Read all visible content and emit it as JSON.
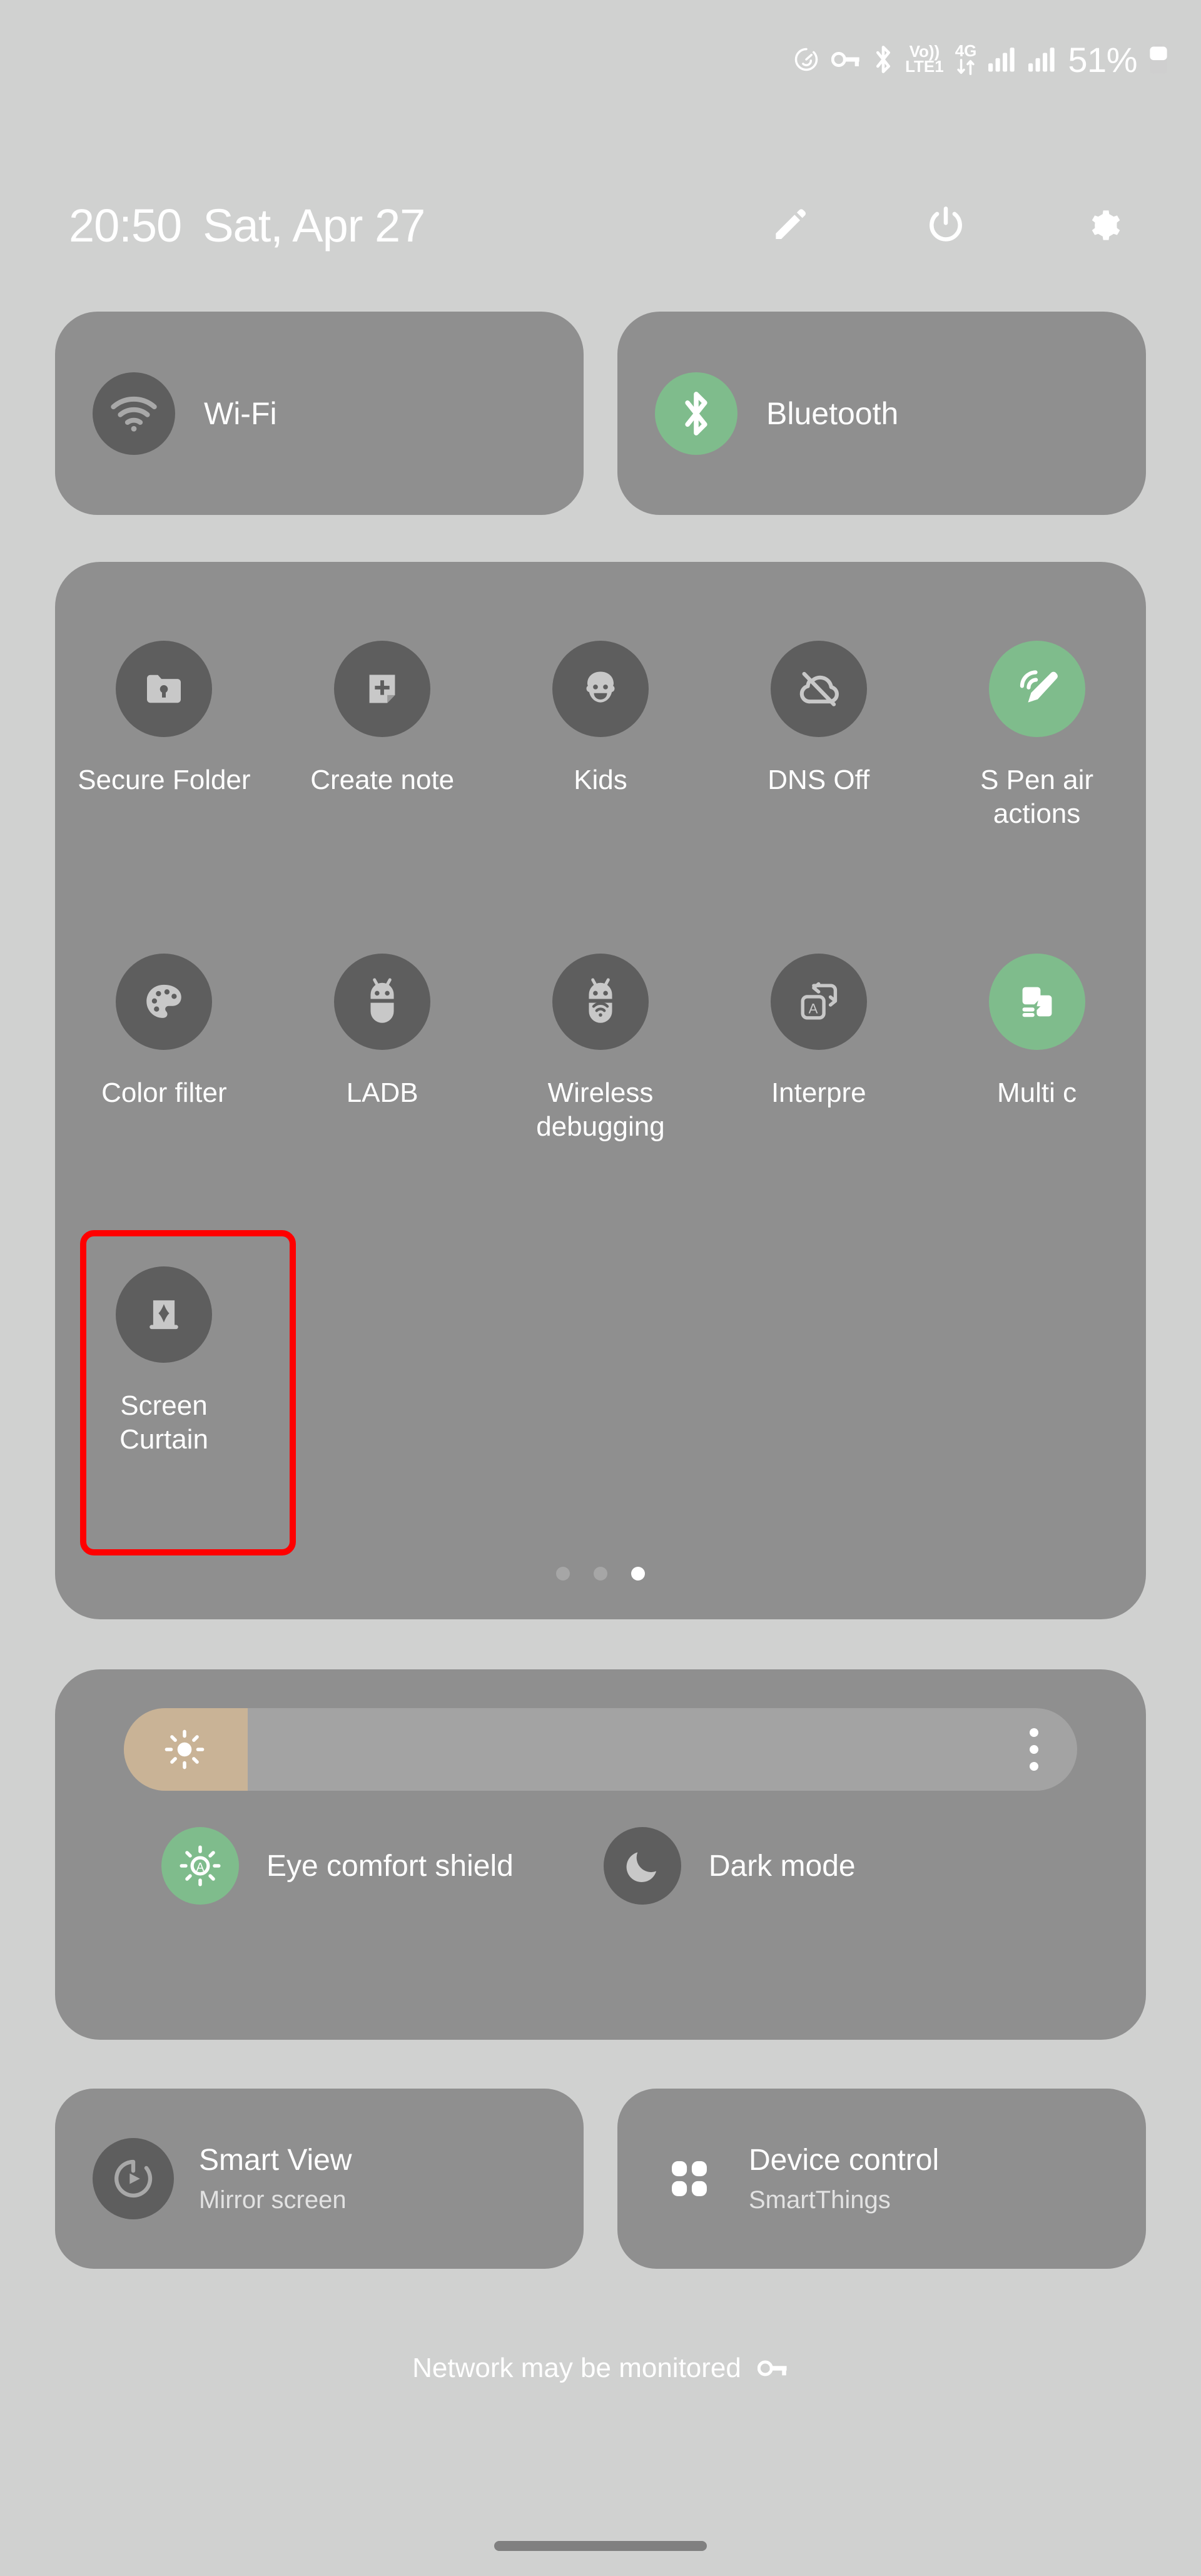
{
  "statusbar": {
    "icons": [
      "dashboard-speed-icon",
      "vpn-key-icon",
      "bluetooth-icon"
    ],
    "volte_top": "Vo))",
    "volte_bottom": "LTE1",
    "network_top": "4G",
    "network_bottom": "arrows-updown-icon",
    "signal_icons": [
      "signal-bars-icon",
      "signal-bars-icon"
    ],
    "battery_percent": "51%",
    "battery_icon": "battery-half-icon"
  },
  "header": {
    "time": "20:50",
    "date": "Sat, Apr 27",
    "actions": [
      {
        "name": "edit-pencil-icon",
        "label": "Edit"
      },
      {
        "name": "power-icon",
        "label": "Power"
      },
      {
        "name": "gear-icon",
        "label": "Settings"
      }
    ]
  },
  "connectivity": [
    {
      "label": "Wi-Fi",
      "icon": "wifi-icon",
      "active": false
    },
    {
      "label": "Bluetooth",
      "icon": "bluetooth-icon",
      "active": true
    }
  ],
  "quick_tiles": {
    "row1": [
      {
        "label": "Secure Folder",
        "icon": "secure-folder-icon",
        "active": false
      },
      {
        "label": "Create note",
        "icon": "create-note-icon",
        "active": false
      },
      {
        "label": "Kids",
        "icon": "kids-face-icon",
        "active": false
      },
      {
        "label": "DNS Off",
        "icon": "dns-off-cloud-icon",
        "active": false
      },
      {
        "label": "S Pen air actions",
        "icon": "spen-air-actions-icon",
        "active": true
      }
    ],
    "row2": [
      {
        "label": "Color filter",
        "icon": "color-palette-icon",
        "active": false
      },
      {
        "label": "LADB",
        "icon": "android-bug-icon",
        "active": false
      },
      {
        "label": "Wireless debugging",
        "icon": "wireless-debug-icon",
        "active": false
      },
      {
        "label": "Interpre",
        "icon": "interpreter-translate-icon",
        "active": false,
        "clipped": true
      },
      {
        "label": "Multi c",
        "icon": "multi-control-icon",
        "active": true,
        "clipped": true
      }
    ],
    "row3": [
      {
        "label": "Screen Curtain",
        "icon": "screen-curtain-icon",
        "active": false,
        "highlighted": true
      }
    ],
    "page_dots": {
      "count": 3,
      "active_index": 2
    }
  },
  "brightness": {
    "slider_icon": "brightness-sun-icon",
    "slider_value_percent": 13,
    "menu_icon": "more-vertical-icon",
    "toggles": [
      {
        "label": "Eye comfort shield",
        "icon": "eye-comfort-auto-icon",
        "active": true
      },
      {
        "label": "Dark mode",
        "icon": "moon-icon",
        "active": false
      }
    ]
  },
  "bottom_cards": [
    {
      "title": "Smart View",
      "subtitle": "Mirror screen",
      "icon": "smart-view-icon"
    },
    {
      "title": "Device control",
      "subtitle": "SmartThings",
      "icon": "device-control-grid-icon"
    }
  ],
  "footer": {
    "text": "Network may be monitored",
    "icon": "vpn-key-icon"
  },
  "navbar": {
    "icon": "home-gesture-pill"
  },
  "colors": {
    "background": "#d0d1d0",
    "panel": "#8f8f8f",
    "circle_inactive": "#5e5e5e",
    "accent_green": "#7fbc8c",
    "text": "#ffffff",
    "highlight_box": "#ff0000",
    "slider_track": "#a3a3a3",
    "slider_fill": "#c9b396"
  }
}
